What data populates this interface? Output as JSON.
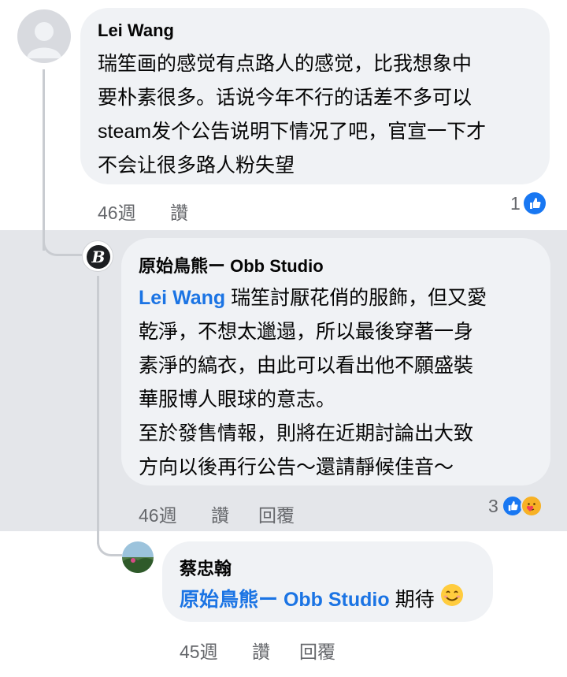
{
  "comment1": {
    "author": "Lei Wang",
    "lines": [
      "瑞笙画的感觉有点路人的感觉，比我想象中",
      "要朴素很多。话说今年不行的话差不多可以",
      "steam发个公告说明下情况了吧，官宣一下才",
      "不会让很多路人粉失望"
    ],
    "time": "46週",
    "like_action": "讚",
    "reaction_count": "1"
  },
  "reply1": {
    "author": "原始鳥熊ー Obb Studio",
    "mention": "Lei Wang",
    "lines": [
      " 瑞笙討厭花俏的服飾，但又愛",
      "乾淨，不想太邋遢，所以最後穿著一身",
      "素淨的縞衣，由此可以看出他不願盛裝",
      "華服博人眼球的意志。",
      "至於發售情報，則將在近期討論出大致",
      "方向以後再行公告～還請靜候佳音～"
    ],
    "time": "46週",
    "like_action": "讚",
    "reply_action": "回覆",
    "reaction_count": "3"
  },
  "reply2": {
    "author": "蔡忠翰",
    "mention": "原始鳥熊ー Obb Studio",
    "text": " 期待",
    "time": "45週",
    "like_action": "讚",
    "reply_action": "回覆"
  },
  "colors": {
    "accent": "#1b74e4",
    "like_blue": "#1877f2",
    "band": "#e4e6ea",
    "bubble": "#f0f2f5"
  }
}
